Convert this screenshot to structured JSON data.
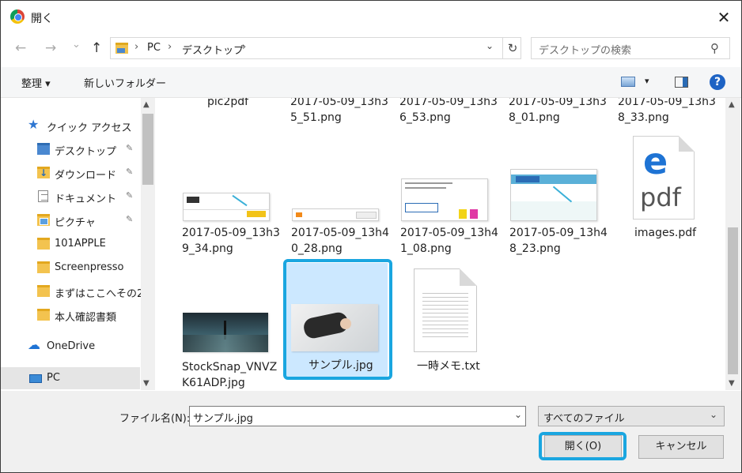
{
  "title": "開く",
  "close_glyph": "✕",
  "nav": {
    "back": "←",
    "forward": "→",
    "recent": "⌄",
    "up": "↑"
  },
  "breadcrumb": {
    "items": [
      "PC",
      "デスクトップ"
    ],
    "sep": "›"
  },
  "address": {
    "dropdown": "⌄",
    "refresh": "↻"
  },
  "search": {
    "placeholder": "デスクトップの検索",
    "icon": "⚲"
  },
  "toolbar": {
    "organize": "整理 ▾",
    "new_folder": "新しいフォルダー",
    "view_drop": "▾",
    "help": "?"
  },
  "sidebar": {
    "quick_access": "クイック アクセス",
    "items": [
      {
        "label": "デスクトップ",
        "pinned": true
      },
      {
        "label": "ダウンロード",
        "pinned": true
      },
      {
        "label": "ドキュメント",
        "pinned": true
      },
      {
        "label": "ピクチャ",
        "pinned": true
      },
      {
        "label": "101APPLE"
      },
      {
        "label": "Screenpresso"
      },
      {
        "label": "まずはここへその2"
      },
      {
        "label": "本人確認書類"
      }
    ],
    "onedrive": "OneDrive",
    "pc": "PC",
    "pin_glyph": "✎",
    "scroll_up": "▲",
    "scroll_down": "▼"
  },
  "files": [
    {
      "name": "pic2pdf"
    },
    {
      "name": "2017-05-09_13h3\n5_51.png"
    },
    {
      "name": "2017-05-09_13h3\n6_53.png"
    },
    {
      "name": "2017-05-09_13h3\n8_01.png"
    },
    {
      "name": "2017-05-09_13h3\n8_33.png"
    },
    {
      "name": "2017-05-09_13h3\n9_34.png"
    },
    {
      "name": "2017-05-09_13h4\n0_28.png"
    },
    {
      "name": "2017-05-09_13h4\n1_08.png"
    },
    {
      "name": "2017-05-09_13h4\n8_23.png"
    },
    {
      "name": "images.pdf"
    },
    {
      "name": "StockSnap_VNVZ\nK61ADP.jpg"
    },
    {
      "name": "サンプル.jpg",
      "selected": true
    },
    {
      "name": "一時メモ.txt"
    }
  ],
  "pdf_icon": {
    "letter": "e",
    "text": "pdf"
  },
  "bottom": {
    "filename_label": "ファイル名(N):",
    "filename_value": "サンプル.jpg",
    "filetype_value": "すべてのファイル",
    "dropdown": "⌄",
    "open_label": "開く(O)",
    "cancel_label": "キャンセル"
  },
  "colors": {
    "highlight": "#1aa6e0",
    "selection": "#cce8ff",
    "accent": "#1e63c4"
  }
}
